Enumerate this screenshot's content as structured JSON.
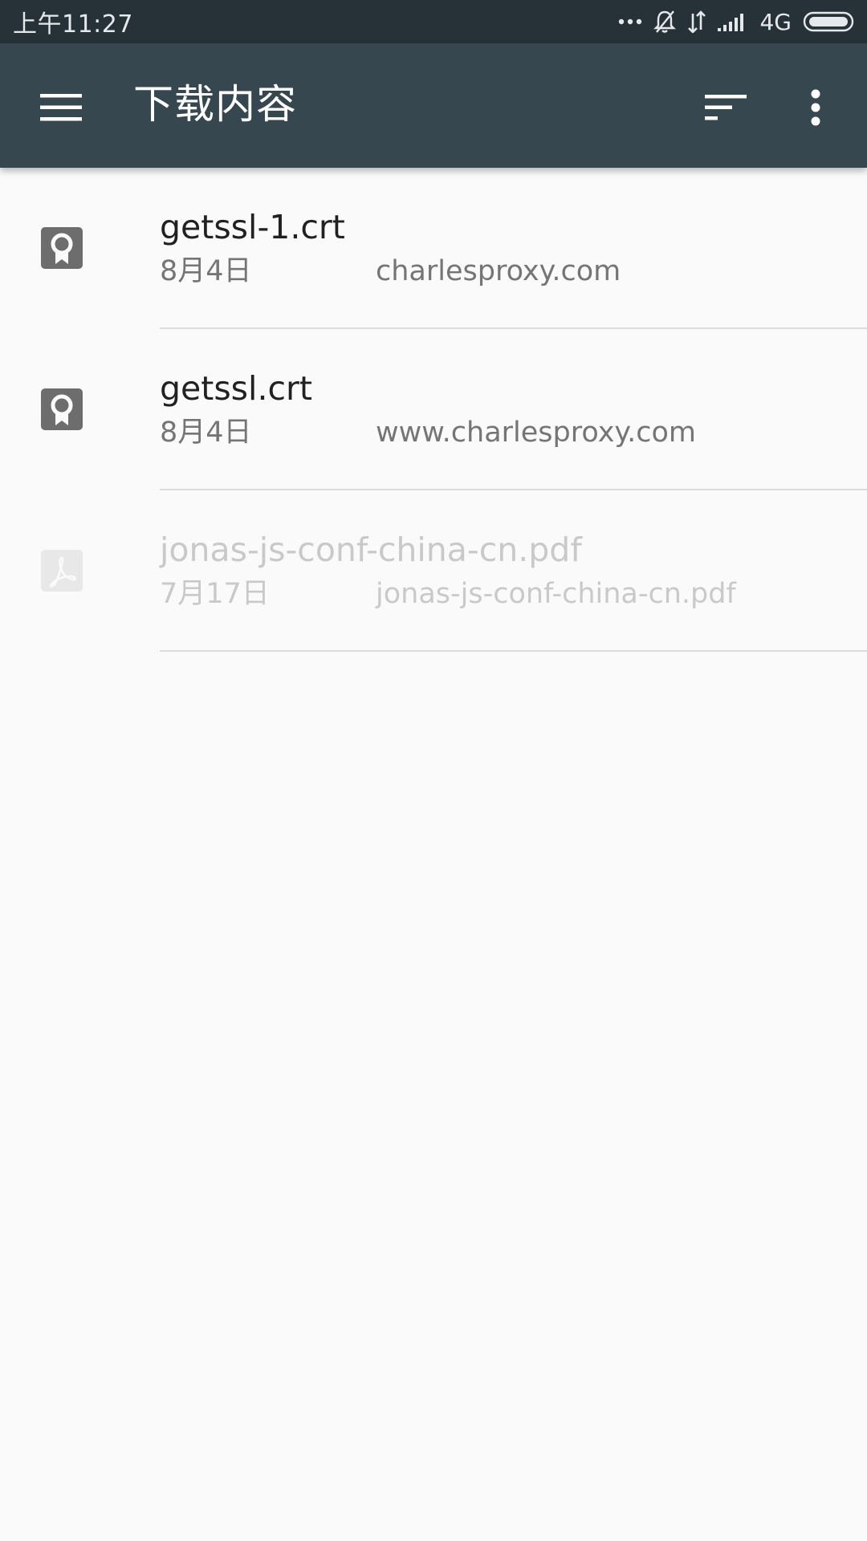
{
  "status_bar": {
    "time": "上午11:27",
    "network": "4G",
    "icons": [
      "more-dots-icon",
      "bell-muted-icon",
      "data-arrows-icon",
      "signal-icon",
      "battery-icon"
    ]
  },
  "toolbar": {
    "title": "下载内容",
    "icons": [
      "menu-icon",
      "sort-icon",
      "more-vert-icon"
    ],
    "background_color": "#37474f"
  },
  "downloads": [
    {
      "name": "getssl-1.crt",
      "date": "8月4日",
      "source": "charlesproxy.com",
      "icon": "certificate-icon",
      "dimmed": false
    },
    {
      "name": "getssl.crt",
      "date": "8月4日",
      "source": "www.charlesproxy.com",
      "icon": "certificate-icon",
      "dimmed": false
    },
    {
      "name": "jonas-js-conf-china-cn.pdf",
      "date": "7月17日",
      "source": "jonas-js-conf-china-cn.pdf",
      "icon": "pdf-icon",
      "dimmed": true
    }
  ],
  "colors": {
    "status_bar": "#263238",
    "background": "#fafafa",
    "primary_text": "#212121",
    "secondary_text": "#757575",
    "dimmed_text": "#c9c9c9",
    "icon_gray": "#6d6d6d"
  }
}
